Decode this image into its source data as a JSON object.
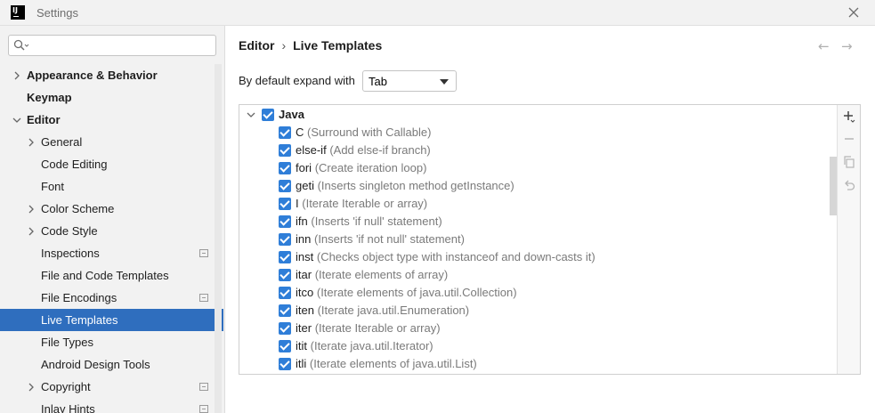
{
  "window": {
    "title": "Settings",
    "logo_text": "IJ"
  },
  "search": {
    "placeholder": "",
    "value": ""
  },
  "sidebar": {
    "items": [
      {
        "label": "Appearance & Behavior",
        "bold": true,
        "expandable": true,
        "expanded": false
      },
      {
        "label": "Keymap",
        "bold": true
      },
      {
        "label": "Editor",
        "bold": true,
        "expandable": true,
        "expanded": true
      },
      {
        "label": "General",
        "expandable": true,
        "expanded": false
      },
      {
        "label": "Code Editing"
      },
      {
        "label": "Font"
      },
      {
        "label": "Color Scheme",
        "expandable": true,
        "expanded": false
      },
      {
        "label": "Code Style",
        "expandable": true,
        "expanded": false
      },
      {
        "label": "Inspections",
        "marker": true
      },
      {
        "label": "File and Code Templates"
      },
      {
        "label": "File Encodings",
        "marker": true
      },
      {
        "label": "Live Templates",
        "selected": true
      },
      {
        "label": "File Types"
      },
      {
        "label": "Android Design Tools"
      },
      {
        "label": "Copyright",
        "expandable": true,
        "expanded": false,
        "marker": true
      },
      {
        "label": "Inlay Hints",
        "marker": true
      }
    ]
  },
  "breadcrumb": {
    "parent": "Editor",
    "separator": "›",
    "current": "Live Templates"
  },
  "nav": {
    "back": "←",
    "forward": "→"
  },
  "expand_with": {
    "label": "By default expand with",
    "value": "Tab"
  },
  "templates": {
    "group": {
      "name": "Java",
      "checked": true,
      "expanded": true
    },
    "items": [
      {
        "abbr": "C",
        "desc": "(Surround with Callable)",
        "checked": true
      },
      {
        "abbr": "else-if",
        "desc": "(Add else-if branch)",
        "checked": true
      },
      {
        "abbr": "fori",
        "desc": "(Create iteration loop)",
        "checked": true
      },
      {
        "abbr": "geti",
        "desc": "(Inserts singleton method getInstance)",
        "checked": true
      },
      {
        "abbr": "I",
        "desc": "(Iterate Iterable or array)",
        "checked": true
      },
      {
        "abbr": "ifn",
        "desc": "(Inserts 'if null' statement)",
        "checked": true
      },
      {
        "abbr": "inn",
        "desc": "(Inserts 'if not null' statement)",
        "checked": true
      },
      {
        "abbr": "inst",
        "desc": "(Checks object type with instanceof and down-casts it)",
        "checked": true
      },
      {
        "abbr": "itar",
        "desc": "(Iterate elements of array)",
        "checked": true
      },
      {
        "abbr": "itco",
        "desc": "(Iterate elements of java.util.Collection)",
        "checked": true
      },
      {
        "abbr": "iten",
        "desc": "(Iterate java.util.Enumeration)",
        "checked": true
      },
      {
        "abbr": "iter",
        "desc": "(Iterate Iterable or array)",
        "checked": true
      },
      {
        "abbr": "itit",
        "desc": "(Iterate java.util.Iterator)",
        "checked": true
      },
      {
        "abbr": "itli",
        "desc": "(Iterate elements of java.util.List)",
        "checked": true
      }
    ]
  },
  "toolbar": {
    "icons": [
      "add-icon",
      "remove-icon",
      "copy-icon",
      "restore-icon"
    ]
  },
  "colors": {
    "accent": "#2f7ed8",
    "selection": "#2f6ebe",
    "sidebar_bg": "#f2f2f2"
  }
}
